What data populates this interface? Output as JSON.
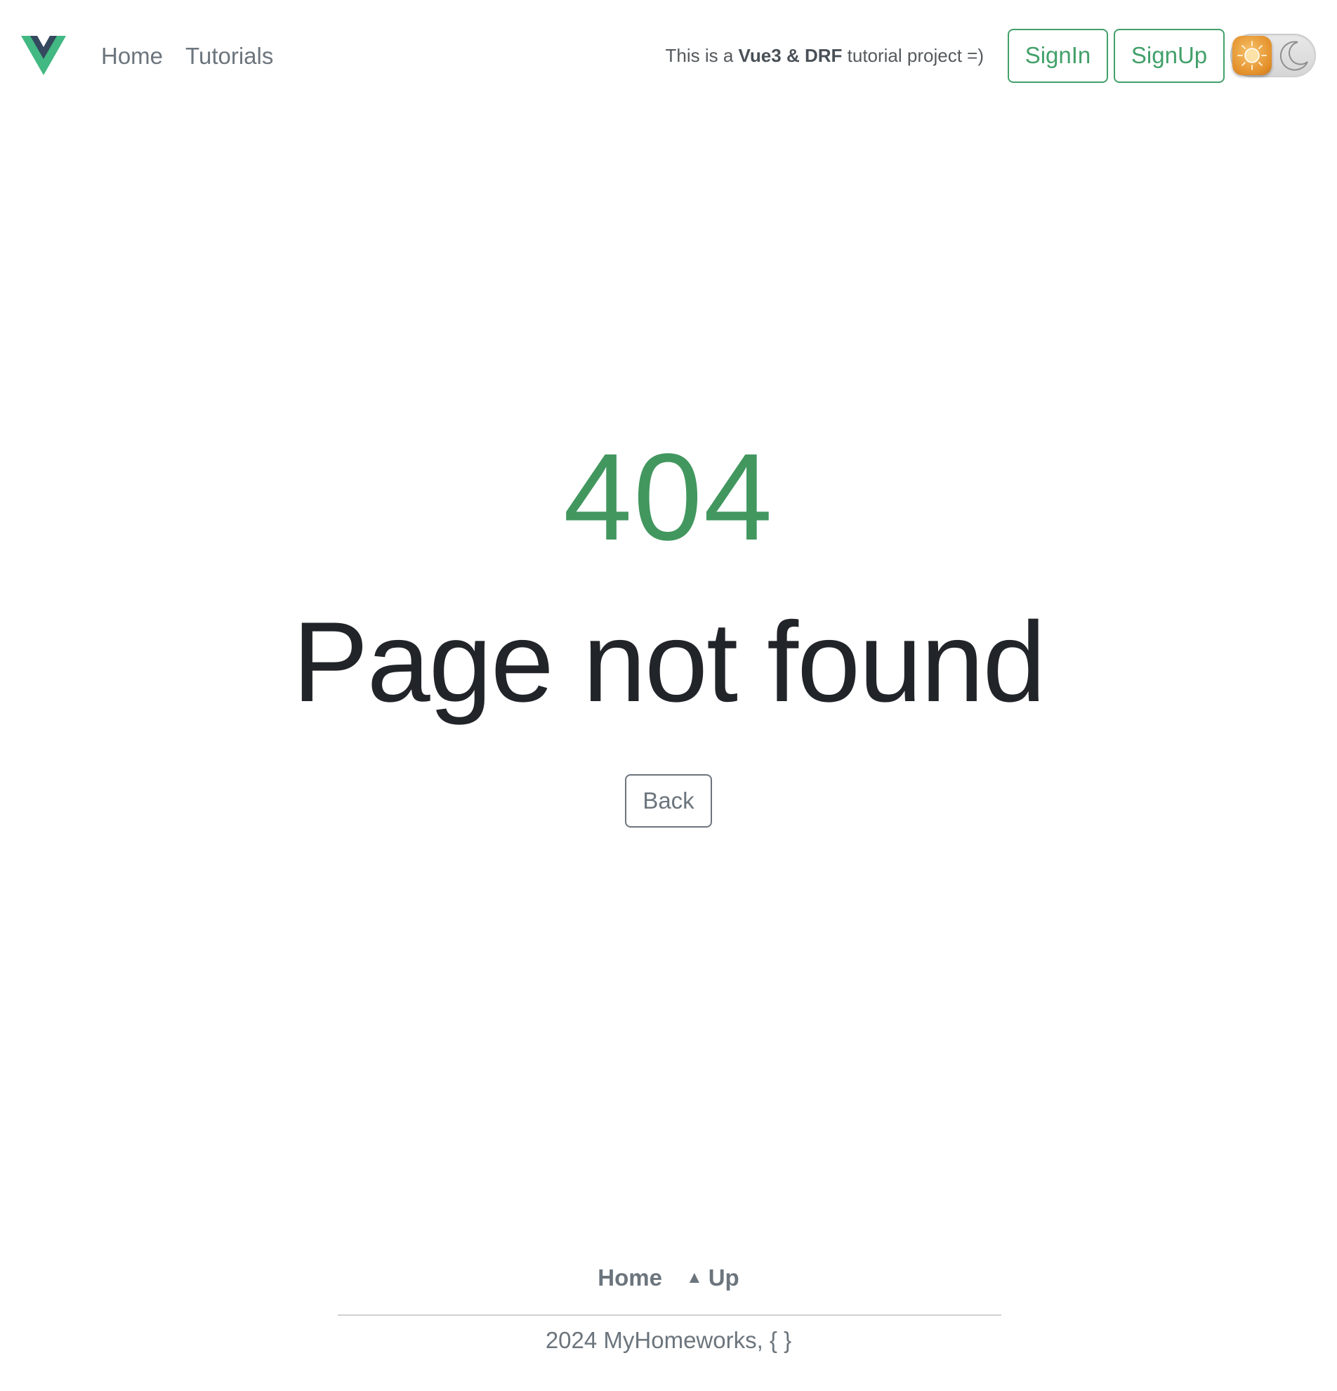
{
  "header": {
    "nav": [
      {
        "label": "Home"
      },
      {
        "label": "Tutorials"
      }
    ],
    "tagline": {
      "prefix": "This is a ",
      "bold1": "Vue3",
      "middle": " & ",
      "bold2": "DRF",
      "suffix": " tutorial project =)"
    },
    "signin_label": "SignIn",
    "signup_label": "SignUp",
    "theme": "light"
  },
  "main": {
    "code": "404",
    "title": "Page not found",
    "back_label": "Back"
  },
  "footer": {
    "home_label": "Home",
    "up_icon": "▲",
    "up_label": "Up",
    "copyright": "2024 MyHomeworks, { }"
  },
  "colors": {
    "brand_green": "#42975f",
    "brand_dark": "#34495e",
    "muted": "#6c757d",
    "text_dark": "#212529"
  }
}
